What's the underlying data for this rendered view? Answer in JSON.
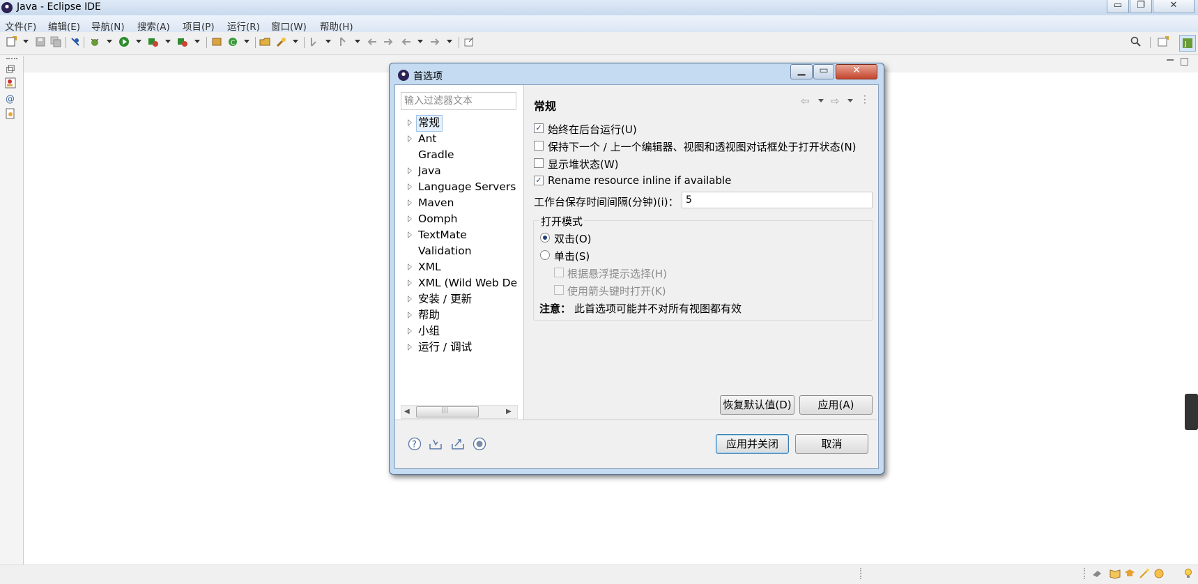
{
  "window": {
    "title": "Java - Eclipse IDE",
    "controls": [
      "▭",
      "❐",
      "✕"
    ]
  },
  "menubar": [
    "文件(F)",
    "编辑(E)",
    "导航(N)",
    "搜索(A)",
    "项目(P)",
    "运行(R)",
    "窗口(W)",
    "帮助(H)"
  ],
  "dialog": {
    "title": "首选项",
    "filter_placeholder": "输入过滤器文本",
    "tree": [
      "常规",
      "Ant",
      "Gradle",
      "Java",
      "Language Servers",
      "Maven",
      "Oomph",
      "TextMate",
      "Validation",
      "XML",
      "XML (Wild Web Dev",
      "安装 / 更新",
      "帮助",
      "小组",
      "运行 / 调试"
    ],
    "tree_selected": "常规",
    "page": {
      "title": "常规",
      "checkboxes": [
        {
          "label": "始终在后台运行(U)",
          "checked": true
        },
        {
          "label": "保持下一个 / 上一个编辑器、视图和透视图对话框处于打开状态(N)",
          "checked": false
        },
        {
          "label": "显示堆状态(W)",
          "checked": false
        },
        {
          "label": "Rename resource inline if available",
          "checked": true
        }
      ],
      "interval_label": "工作台保存时间间隔(分钟)(i)：",
      "interval_value": "5",
      "open_mode": {
        "legend": "打开模式",
        "double_click": "双击(O)",
        "single_click": "单击(S)",
        "hover_select": "根据悬浮提示选择(H)",
        "arrow_open": "使用箭头键时打开(K)",
        "selected": "double_click"
      },
      "note_label": "注意：",
      "note_text": "此首选项可能并不对所有视图都有效",
      "restore_defaults": "恢复默认值(D)",
      "apply": "应用(A)"
    },
    "apply_and_close": "应用并关闭",
    "cancel": "取消"
  },
  "colors": {
    "dialog_frame": "#c5dbf1",
    "close_button": "#c4452d",
    "check_mark": "#1d3f73"
  }
}
